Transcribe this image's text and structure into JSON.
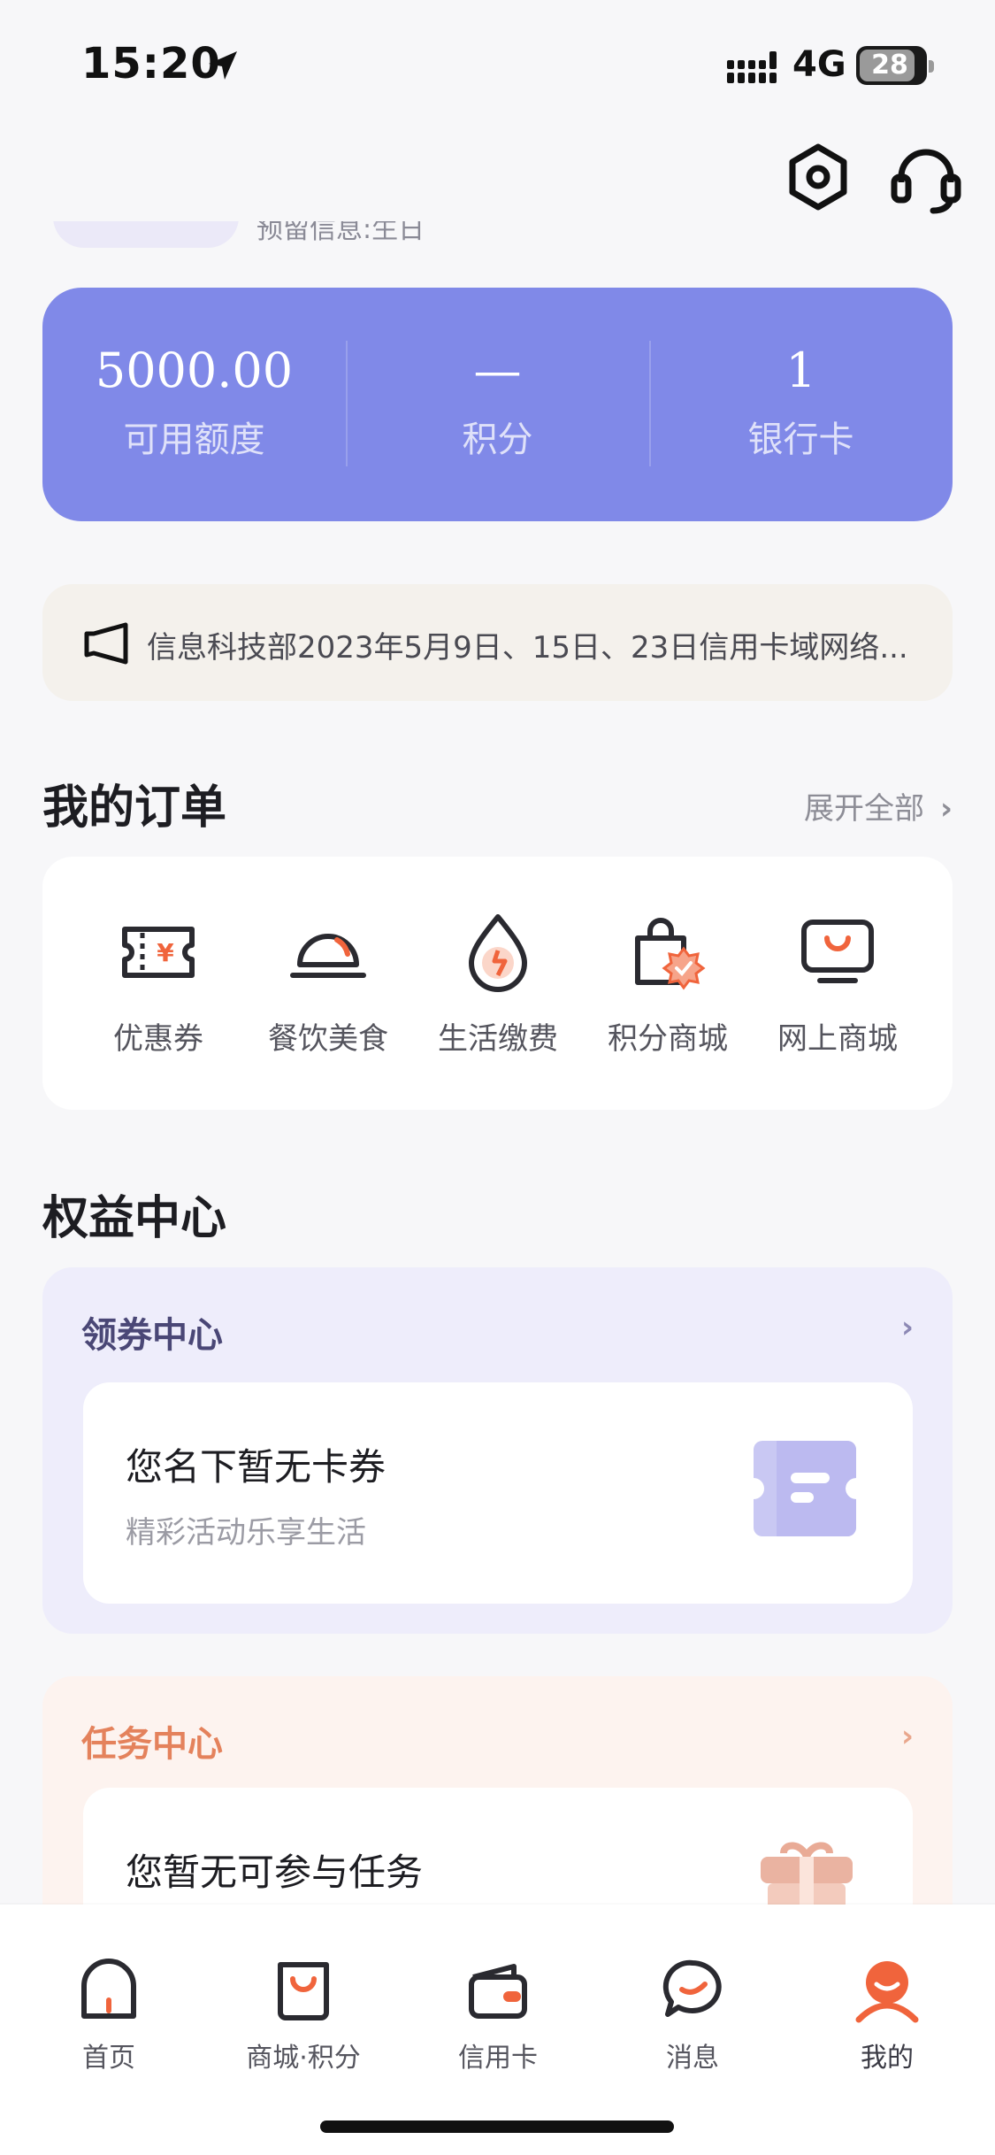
{
  "status_bar": {
    "time": "15:20",
    "network": "4G",
    "battery": "28"
  },
  "header": {
    "partial_text": "预留信息:生日"
  },
  "quota": [
    {
      "value": "5000.00",
      "label": "可用额度"
    },
    {
      "value": "—",
      "label": "积分"
    },
    {
      "value": "1",
      "label": "银行卡"
    }
  ],
  "notice": {
    "text": "信息科技部2023年5月9日、15日、23日信用卡域网络..."
  },
  "orders": {
    "title": "我的订单",
    "expand_label": "展开全部",
    "items": [
      {
        "label": "优惠券",
        "icon": "coupon-icon"
      },
      {
        "label": "餐饮美食",
        "icon": "food-cloche-icon"
      },
      {
        "label": "生活缴费",
        "icon": "utility-drop-icon"
      },
      {
        "label": "积分商城",
        "icon": "points-bag-icon"
      },
      {
        "label": "网上商城",
        "icon": "online-store-icon"
      }
    ]
  },
  "rights": {
    "title": "权益中心",
    "coupon_center": {
      "title": "领券中心",
      "main": "您名下暂无卡券",
      "sub": "精彩活动乐享生活"
    },
    "task_center": {
      "title": "任务中心",
      "main": "您暂无可参与任务"
    }
  },
  "tabs": [
    {
      "label": "首页",
      "icon": "home-icon"
    },
    {
      "label": "商城·积分",
      "icon": "shop-bag-icon"
    },
    {
      "label": "信用卡",
      "icon": "wallet-icon"
    },
    {
      "label": "消息",
      "icon": "message-icon"
    },
    {
      "label": "我的",
      "icon": "profile-icon",
      "active": true
    }
  ],
  "colors": {
    "quota_card": "#8089e8",
    "accent_orange": "#f0643c",
    "coupon_panel": "#eeedfb",
    "task_panel": "#fdf3ef",
    "task_title": "#e4825c"
  }
}
